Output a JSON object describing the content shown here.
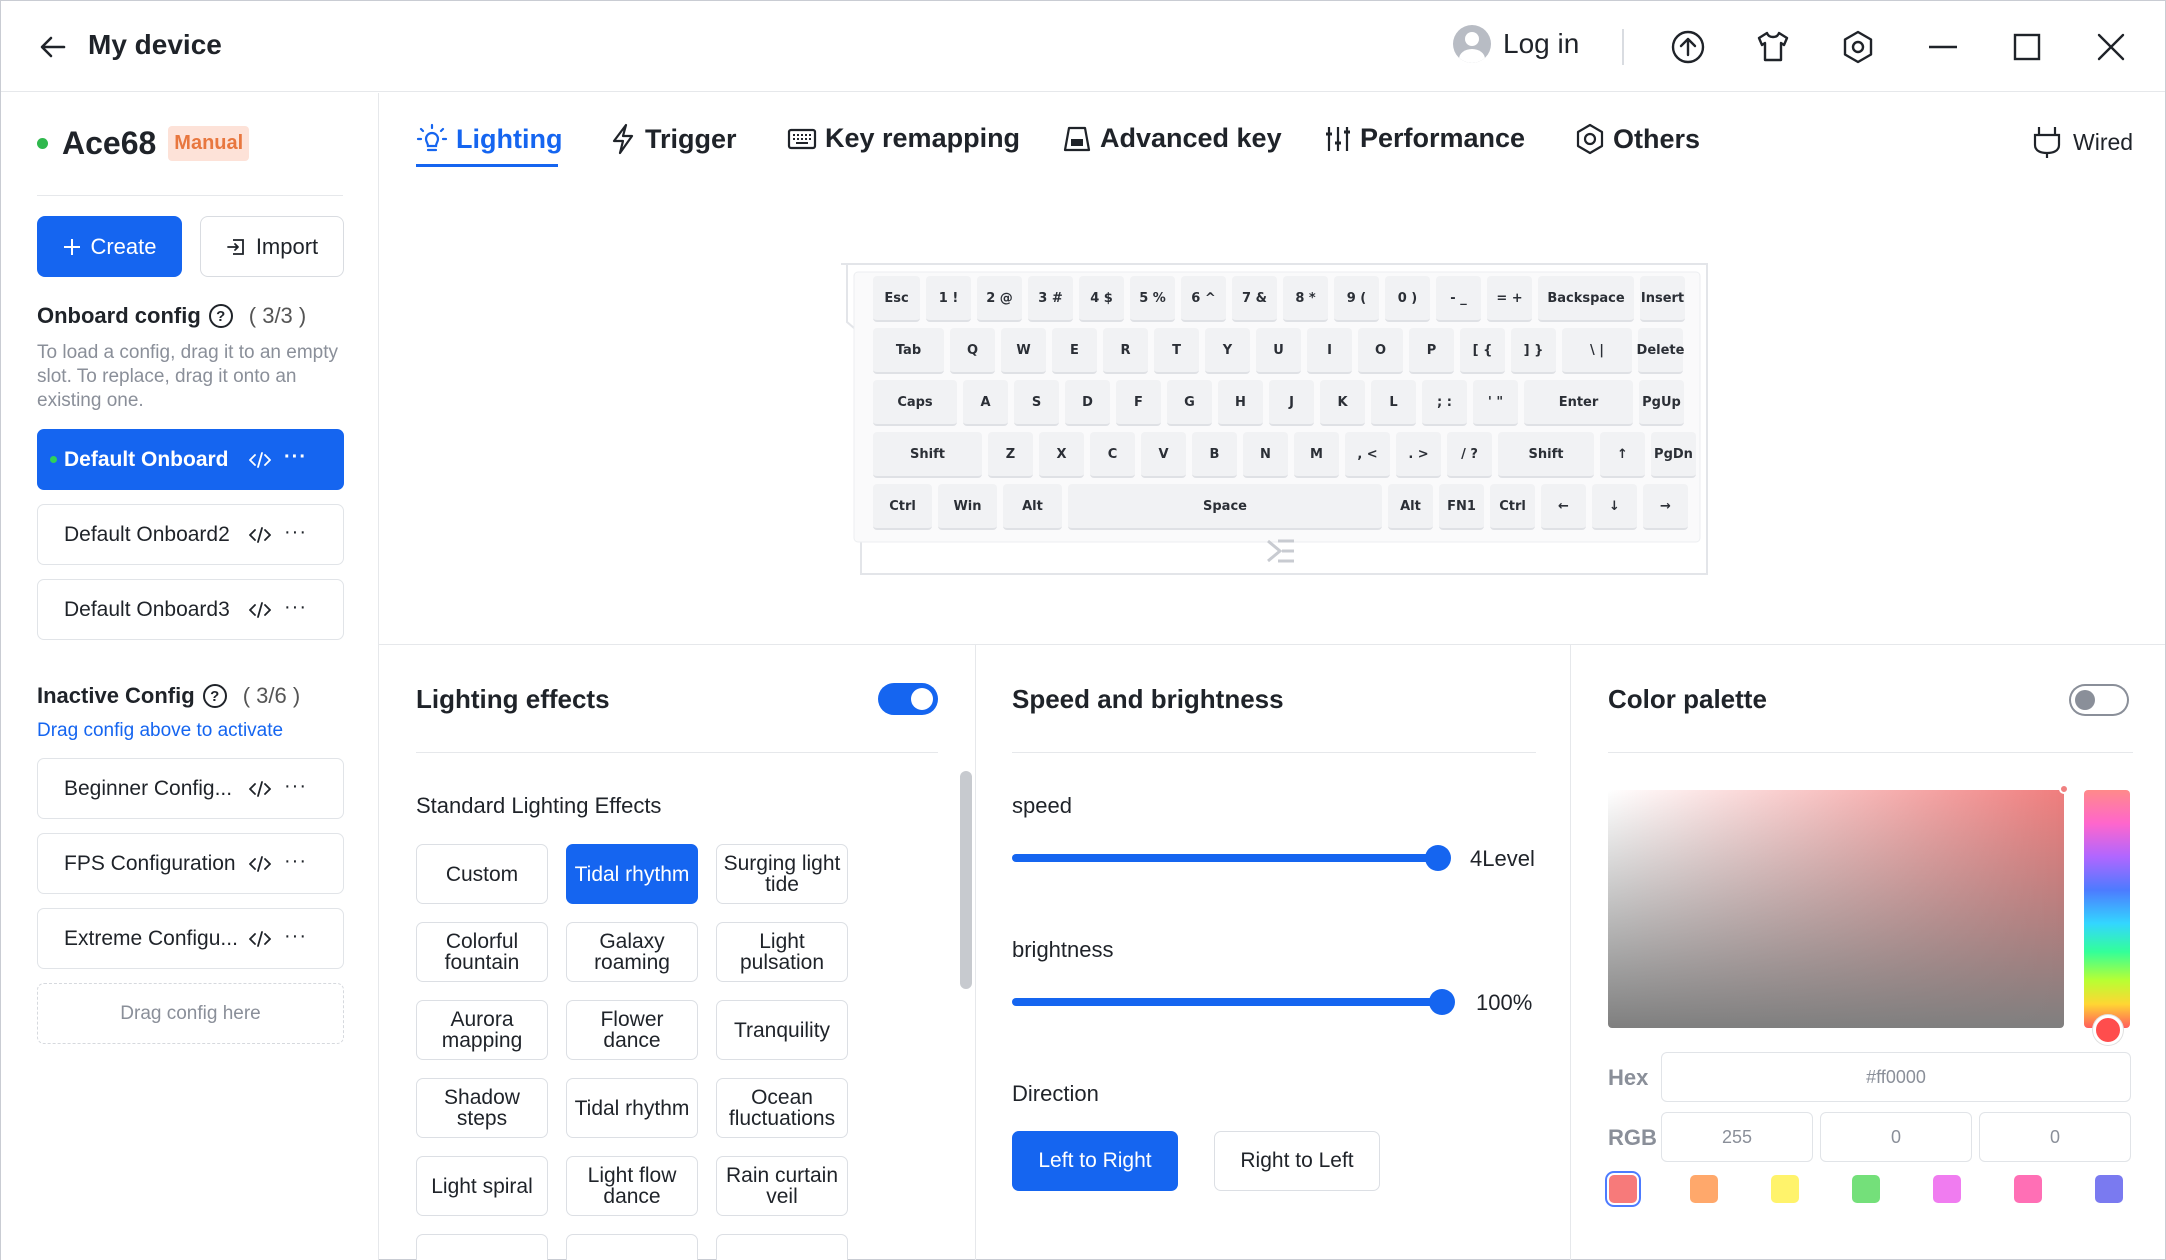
{
  "titlebar": {
    "title": "My device",
    "login_label": "Log in"
  },
  "device": {
    "name": "Ace68",
    "badge": "Manual"
  },
  "sidebar": {
    "create_label": "Create",
    "import_label": "Import",
    "onboard_title": "Onboard config",
    "onboard_count": "( 3/3 )",
    "onboard_hint": "To load a config, drag it to an empty slot. To replace, drag it onto an existing one.",
    "onboard_items": [
      "Default Onboard",
      "Default Onboard2",
      "Default Onboard3"
    ],
    "inactive_title": "Inactive Config",
    "inactive_count": "( 3/6 )",
    "inactive_hint": "Drag config above to activate",
    "inactive_items": [
      "Beginner Config...",
      "FPS Configuration",
      "Extreme Configu..."
    ],
    "drop_label": "Drag config here"
  },
  "tabs": {
    "lighting": "Lighting",
    "trigger": "Trigger",
    "remap": "Key remapping",
    "advanced": "Advanced key",
    "performance": "Performance",
    "others": "Others",
    "connection": "Wired"
  },
  "keyboard": {
    "rows": [
      [
        "Esc",
        "1 !",
        "2 @",
        "3 #",
        "4 $",
        "5 %",
        "6 ^",
        "7 &",
        "8 *",
        "9 (",
        "0 )",
        "- _",
        "= +",
        "Backspace",
        "Insert"
      ],
      [
        "Tab",
        "Q",
        "W",
        "E",
        "R",
        "T",
        "Y",
        "U",
        "I",
        "O",
        "P",
        "[ {",
        "] }",
        "\\ |",
        "Delete"
      ],
      [
        "Caps",
        "A",
        "S",
        "D",
        "F",
        "G",
        "H",
        "J",
        "K",
        "L",
        "; :",
        "' \"",
        "Enter",
        "PgUp"
      ],
      [
        "Shift",
        "Z",
        "X",
        "C",
        "V",
        "B",
        "N",
        "M",
        ", <",
        ". >",
        "/ ?",
        "Shift",
        "↑",
        "PgDn"
      ],
      [
        "Ctrl",
        "Win",
        "Alt",
        "Space",
        "Alt",
        "FN1",
        "Ctrl",
        "←",
        "↓",
        "→"
      ]
    ]
  },
  "lighting_effects": {
    "title": "Lighting effects",
    "enabled": true,
    "section_label": "Standard Lighting Effects",
    "effects": [
      "Custom",
      "Tidal rhythm",
      "Surging light tide",
      "Colorful fountain",
      "Galaxy roaming",
      "Light pulsation",
      "Aurora mapping",
      "Flower dance",
      "Tranquility",
      "Shadow steps",
      "Tidal rhythm",
      "Ocean fluctuations",
      "Light spiral",
      "Light flow dance",
      "Rain curtain veil"
    ],
    "selected_index": 1
  },
  "speed_brightness": {
    "title": "Speed and brightness",
    "speed_label": "speed",
    "speed_value": "4Level",
    "speed_fraction": 1.0,
    "brightness_label": "brightness",
    "brightness_value": "100%",
    "brightness_fraction": 1.0,
    "direction_label": "Direction",
    "dir_left": "Left to Right",
    "dir_right": "Right to Left"
  },
  "palette": {
    "title": "Color palette",
    "enabled": false,
    "hex_label": "Hex",
    "hex_value": "#ff0000",
    "rgb_label": "RGB",
    "r": "255",
    "g": "0",
    "b": "0",
    "swatches": [
      "#f77a7a",
      "#ffa86b",
      "#fff36b",
      "#74e07a",
      "#f07cf0",
      "#ff6fb5",
      "#7a7af0"
    ]
  }
}
